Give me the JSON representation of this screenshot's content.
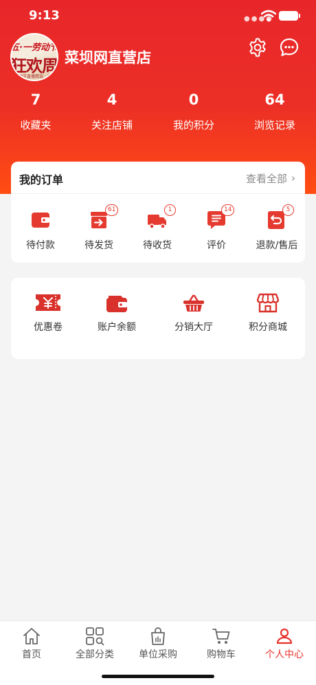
{
  "status_bar": {
    "time": "9:13"
  },
  "header": {
    "avatar_text": {
      "line1": "五·一劳动节",
      "line2": "狂欢周",
      "line3": "劳动节直播精选 · 惠享精彩"
    },
    "shop_name": "菜坝网直营店",
    "settings_icon": "gear-icon",
    "message_icon": "chat-bubble-icon"
  },
  "stats": [
    {
      "value": "7",
      "label": "收藏夹"
    },
    {
      "value": "4",
      "label": "关注店铺"
    },
    {
      "value": "0",
      "label": "我的积分"
    },
    {
      "value": "64",
      "label": "浏览记录"
    }
  ],
  "orders": {
    "title": "我的订单",
    "view_all": "查看全部",
    "items": [
      {
        "label": "待付款",
        "badge": "",
        "icon": "wallet-icon"
      },
      {
        "label": "待发货",
        "badge": "61",
        "icon": "box-send-icon"
      },
      {
        "label": "待收货",
        "badge": "1",
        "icon": "truck-icon"
      },
      {
        "label": "评价",
        "badge": "14",
        "icon": "review-icon"
      },
      {
        "label": "退款/售后",
        "badge": "5",
        "icon": "refund-icon"
      }
    ]
  },
  "services": [
    {
      "label": "优惠卷",
      "icon": "coupon-icon"
    },
    {
      "label": "账户余额",
      "icon": "wallet-icon"
    },
    {
      "label": "分销大厅",
      "icon": "basket-icon"
    },
    {
      "label": "积分商城",
      "icon": "store-icon"
    }
  ],
  "tabbar": {
    "items": [
      {
        "label": "首页",
        "icon": "home-icon",
        "active": false
      },
      {
        "label": "全部分类",
        "icon": "category-grid-icon",
        "active": false
      },
      {
        "label": "单位采购",
        "icon": "shopping-bag-icon",
        "active": false
      },
      {
        "label": "购物车",
        "icon": "cart-icon",
        "active": false
      },
      {
        "label": "个人中心",
        "icon": "person-icon",
        "active": true
      }
    ]
  },
  "colors": {
    "brand_red": "#e9302a",
    "accent_red": "#e63a2e",
    "gradient_bottom": "#ff4d12"
  }
}
